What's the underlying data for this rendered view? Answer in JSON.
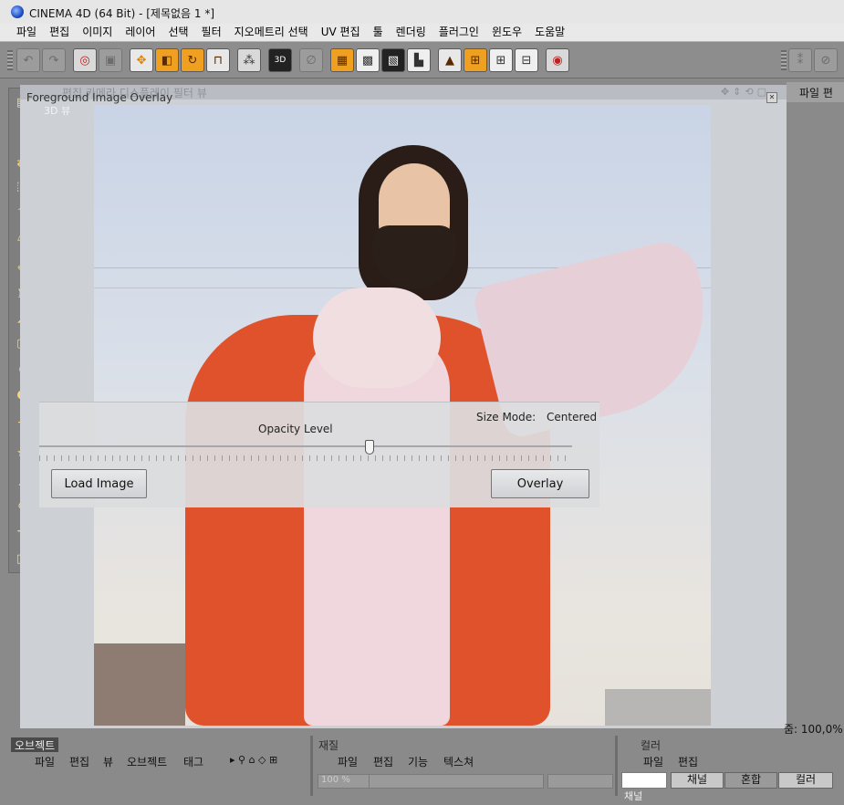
{
  "window": {
    "title": "CINEMA 4D (64 Bit) - [제목없음 1 *]"
  },
  "menubar": [
    "파일",
    "편집",
    "이미지",
    "레이어",
    "선택",
    "필터",
    "지오메트리 선택",
    "UV 편집",
    "툴",
    "렌더링",
    "플러그인",
    "윈도우",
    "도움말"
  ],
  "viewport": {
    "menu": "편집   카메라   디스플레이   필터   뷰",
    "label": "3D 뷰",
    "overlay_title": "Foreground Image Overlay"
  },
  "overlay": {
    "size_mode_label": "Size Mode:",
    "size_mode_value": "Centered",
    "opacity_label": "Opacity Level",
    "opacity_value": 0.62,
    "load_button": "Load Image",
    "overlay_button": "Overlay"
  },
  "right_panel": {
    "menu_file": "파일  편",
    "zoom": "줌: 100,0%"
  },
  "bottom": {
    "objects": {
      "tab": "오브젝트",
      "menu": [
        "파일",
        "편집",
        "뷰",
        "오브젝트",
        "태그"
      ]
    },
    "materials": {
      "tab": "재질",
      "menu": [
        "파일",
        "편집",
        "기능",
        "텍스쳐"
      ],
      "zoom": "100 %"
    },
    "color": {
      "tab": "컬러",
      "menu": [
        "파일",
        "편집"
      ],
      "tabs": [
        "채널",
        "혼합",
        "컬러"
      ],
      "row": "채널"
    }
  },
  "colors": {
    "accent": "#f0a020",
    "viewport_bg": "#cdd1d6"
  }
}
